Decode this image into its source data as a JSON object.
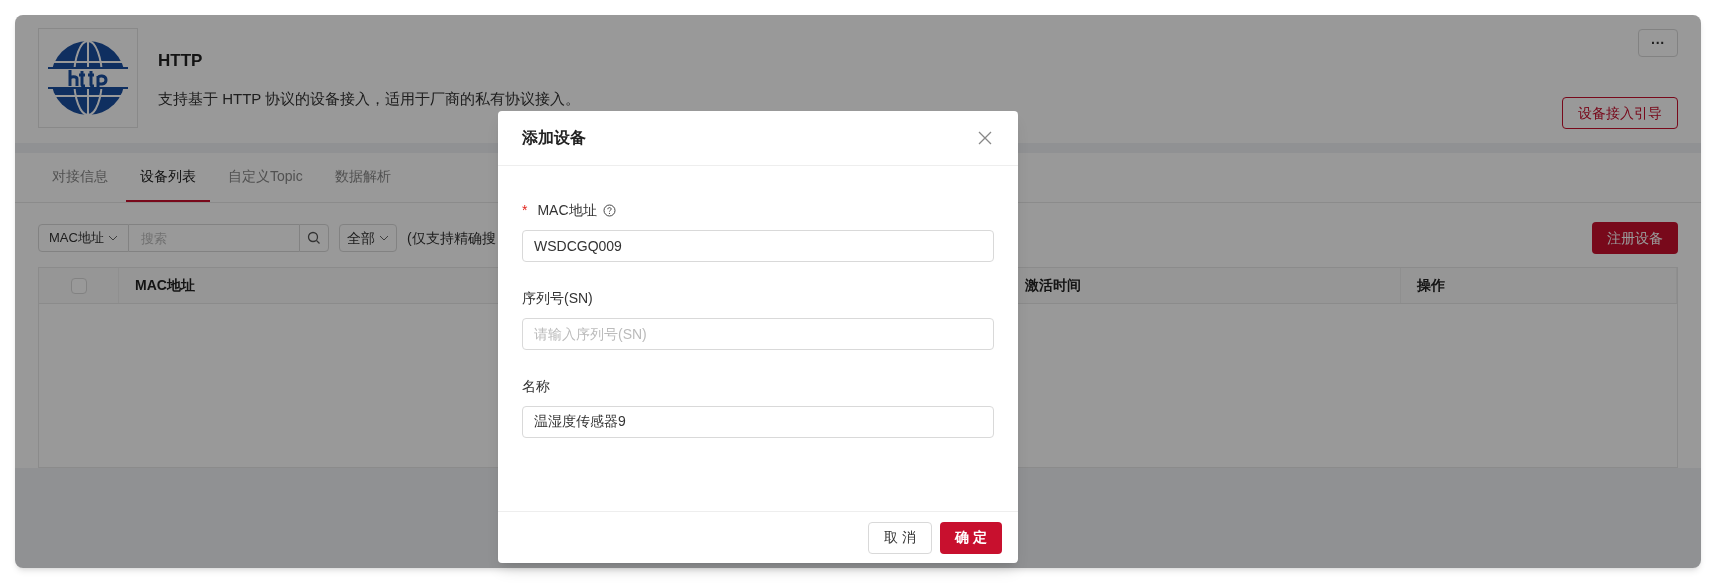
{
  "header": {
    "title": "HTTP",
    "description": "支持基于 HTTP 协议的设备接入，适用于厂商的私有协议接入。",
    "more_button": "···",
    "guide_button": "设备接入引导"
  },
  "tabs": [
    {
      "label": "对接信息",
      "selected": false
    },
    {
      "label": "设备列表",
      "selected": true
    },
    {
      "label": "自定义Topic",
      "selected": false
    },
    {
      "label": "数据解析",
      "selected": false
    }
  ],
  "toolbar": {
    "search_type": "MAC地址",
    "search_placeholder": "搜索",
    "status_filter": "全部",
    "hint": "(仅支持精确搜",
    "register_button": "注册设备"
  },
  "table": {
    "select_all_checked": false,
    "columns": [
      "MAC地址",
      "激活时间",
      "操作"
    ]
  },
  "dialog": {
    "title": "添加设备",
    "required_mark": "*",
    "fields": [
      {
        "label": "MAC地址",
        "required": true,
        "help": true,
        "value": "WSDCGQ009"
      },
      {
        "label": "序列号(SN)",
        "required": false,
        "help": false,
        "placeholder": "请输入序列号(SN)"
      },
      {
        "label": "名称",
        "required": false,
        "help": false,
        "value": "温湿度传感器9"
      }
    ],
    "cancel_button": "取 消",
    "ok_button": "确 定"
  }
}
